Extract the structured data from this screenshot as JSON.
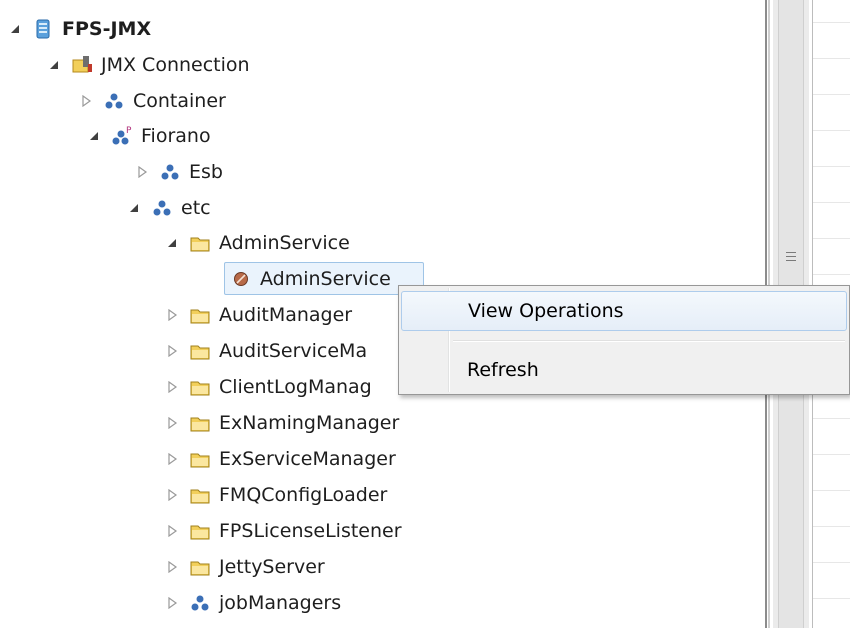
{
  "tree": {
    "nodes": [
      {
        "label": "FPS-JMX",
        "icon": "server-icon",
        "expander": "expanded",
        "bold": true
      },
      {
        "label": "JMX Connection",
        "icon": "connection-icon",
        "expander": "expanded"
      },
      {
        "label": "Container",
        "icon": "domain-icon",
        "expander": "collapsed"
      },
      {
        "label": "Fiorano",
        "icon": "domain-plugin-icon",
        "expander": "expanded"
      },
      {
        "label": "Esb",
        "icon": "domain-icon",
        "expander": "collapsed"
      },
      {
        "label": "etc",
        "icon": "domain-icon",
        "expander": "expanded"
      },
      {
        "label": "AdminService",
        "icon": "folder-icon",
        "expander": "expanded"
      },
      {
        "label": "AdminService",
        "icon": "mbean-icon",
        "expander": "none",
        "selected": true
      },
      {
        "label": "AuditManager",
        "icon": "folder-icon",
        "expander": "collapsed"
      },
      {
        "label": "AuditServiceMa",
        "icon": "folder-icon",
        "expander": "collapsed"
      },
      {
        "label": "ClientLogManag",
        "icon": "folder-icon",
        "expander": "collapsed"
      },
      {
        "label": "ExNamingManager",
        "icon": "folder-icon",
        "expander": "collapsed"
      },
      {
        "label": "ExServiceManager",
        "icon": "folder-icon",
        "expander": "collapsed"
      },
      {
        "label": "FMQConfigLoader",
        "icon": "folder-icon",
        "expander": "collapsed"
      },
      {
        "label": "FPSLicenseListener",
        "icon": "folder-icon",
        "expander": "collapsed"
      },
      {
        "label": "JettyServer",
        "icon": "folder-icon",
        "expander": "collapsed"
      },
      {
        "label": "jobManagers",
        "icon": "domain-icon",
        "expander": "collapsed"
      }
    ]
  },
  "context_menu": {
    "items": [
      {
        "label": "View Operations",
        "highlighted": true
      },
      {
        "label": "Refresh",
        "highlighted": false
      }
    ]
  },
  "colors": {
    "selection_border": "#9fc4e6",
    "selection_fill": "#eaf3fc",
    "menu_background": "#f0f0f0",
    "menu_highlight_border": "#aeccec",
    "folder_yellow": "#f2cf5a",
    "domain_blue": "#3b6fb6"
  }
}
